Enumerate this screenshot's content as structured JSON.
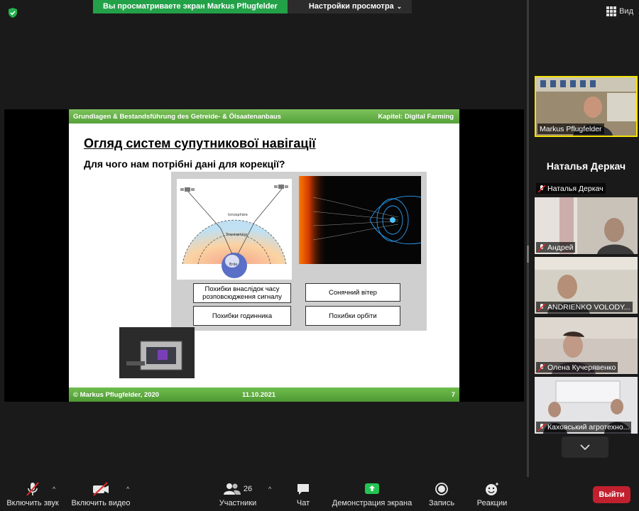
{
  "banner": {
    "sharing_text": "Вы просматриваете экран Markus Pflugfelder",
    "view_options_label": "Настройки просмотра"
  },
  "view_button": {
    "label": "Вид"
  },
  "slide": {
    "header_left": "Grundlagen & Bestandsführung des Getreide- & Ölsaatenanbaus",
    "header_right": "Kapitel: Digital Farming",
    "title": "Огляд систем супутникової навігації",
    "subtitle": "Для чого нам потрібні дані для корекції?",
    "diagram_labels": {
      "ionosphere": "Ionosphäre",
      "troposphere": "Troposphäre",
      "earth": "Erde"
    },
    "boxes": [
      "Похибки внаслідок часу розповсюдження сигналу",
      "Сонячний вітер",
      "Похибки годинника",
      "Похибки орбіти"
    ],
    "footer_copyright": "© Markus Pflugfelder, 2020",
    "footer_date": "11.10.2021",
    "footer_page": "7"
  },
  "participants": {
    "active_speaker": "Markus Pflugfelder",
    "name_only_display": "Наталья Деркач",
    "name_only_label": "Наталья Деркач",
    "videos": [
      "Андрей",
      "ANDRIENKO VOLODY...",
      "Олена Кучерявенко",
      "Каховський агротехно..."
    ]
  },
  "toolbar": {
    "mute": "Включить звук",
    "video": "Включить видео",
    "participants": "Участники",
    "participants_count": "26",
    "chat": "Чат",
    "share": "Демонстрация экрана",
    "record": "Запись",
    "reactions": "Реакции",
    "exit": "Выйти"
  },
  "colors": {
    "share_green": "#23a149",
    "slide_green": "#5aa83d",
    "active_border": "#f3e200",
    "exit_red": "#c2202e",
    "muted_red": "#e02828"
  }
}
